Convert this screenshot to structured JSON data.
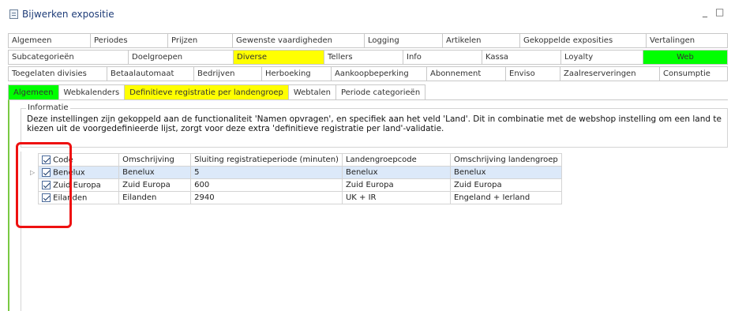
{
  "window": {
    "title": "Bijwerken expositie",
    "minimize": "_",
    "maximize": "□"
  },
  "tabs_row1": [
    "Algemeen",
    "Periodes",
    "Prijzen",
    "Gewenste vaardigheden",
    "Logging",
    "Artikelen",
    "Gekoppelde exposities",
    "Vertalingen"
  ],
  "tabs_row2": [
    "Subcategorieën",
    "Doelgroepen",
    "Diverse",
    "Tellers",
    "Info",
    "Kassa",
    "Loyalty",
    "Web"
  ],
  "tabs_row3": [
    "Toegelaten divisies",
    "Betaalautomaat",
    "Bedrijven",
    "Herboeking",
    "Aankoopbeperking",
    "Abonnement",
    "Enviso",
    "Zaalreserveringen",
    "Consumptie"
  ],
  "subtabs": [
    "Algemeen",
    "Webkalenders",
    "Definitieve registratie per landengroep",
    "Webtalen",
    "Periode categorieën"
  ],
  "colors": {
    "active_green": "#00ff00",
    "active_yellow": "#ffff00",
    "highlight_red": "#ee1111"
  },
  "info": {
    "label": "Informatie",
    "text": "Deze instellingen zijn gekoppeld aan de functionaliteit 'Namen opvragen', en specifiek aan het veld 'Land'. Dit in combinatie met de webshop instelling om een land te kiezen uit de voorgedefinieerde lijst, zorgt voor deze extra 'definitieve registratie per land'-validatie."
  },
  "grid": {
    "headers": [
      "Code",
      "Omschrijving",
      "Sluiting registratieperiode (minuten)",
      "Landengroepcode",
      "Omschrijving landengroep"
    ],
    "rows": [
      {
        "checked": true,
        "code": "Benelux",
        "omschrijving": "Benelux",
        "sluiting": "5",
        "groepcode": "Benelux",
        "groepomschrijving": "Benelux"
      },
      {
        "checked": true,
        "code": "Zuid Europa",
        "omschrijving": "Zuid Europa",
        "sluiting": "600",
        "groepcode": "Zuid Europa",
        "groepomschrijving": "Zuid Europa"
      },
      {
        "checked": true,
        "code": "Eilanden",
        "omschrijving": "Eilanden",
        "sluiting": "2940",
        "groepcode": "UK + IR",
        "groepomschrijving": "Engeland + Ierland"
      }
    ]
  }
}
